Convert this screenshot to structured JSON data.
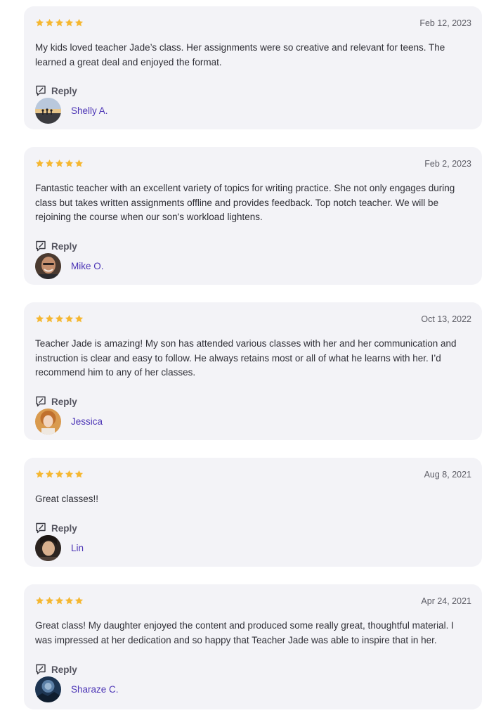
{
  "colors": {
    "star": "#f5b731",
    "author_link": "#4b34b5",
    "card_background": "#f3f3f7"
  },
  "reply_label": "Reply",
  "reviews": [
    {
      "rating": 5,
      "date": "Feb 12, 2023",
      "text": "My kids loved teacher Jade’s class.  Her assignments were so creative and relevant for teens.  The learned a great deal and enjoyed the format.",
      "author": "Shelly A.",
      "avatar_icon": "avatar-photo-sunset-icon"
    },
    {
      "rating": 5,
      "date": "Feb 2, 2023",
      "text": "Fantastic teacher with an excellent variety of topics for writing practice.  She not only engages during class but takes written assignments offline and provides feedback.  Top notch teacher.  We will be rejoining the course when our son's workload lightens.",
      "author": "Mike O.",
      "avatar_icon": "avatar-photo-man-icon"
    },
    {
      "rating": 5,
      "date": "Oct 13, 2022",
      "text": "Teacher Jade is amazing! My son has attended various classes with her and her communication and instruction is clear and easy to follow. He always retains most or all of what he learns with her. I’d recommend him to any of her classes.",
      "author": "Jessica",
      "avatar_icon": "avatar-photo-woman-icon"
    },
    {
      "rating": 5,
      "date": "Aug 8, 2021",
      "text": "Great classes!!",
      "author": "Lin",
      "avatar_icon": "avatar-photo-woman-dark-hair-icon"
    },
    {
      "rating": 5,
      "date": "Apr 24, 2021",
      "text": "Great class! My daughter enjoyed the content and produced some really great, thoughtful material. I was impressed at her dedication and so happy that Teacher Jade was able to inspire that in her.",
      "author": "Sharaze C.",
      "avatar_icon": "avatar-photo-night-sky-icon"
    }
  ]
}
